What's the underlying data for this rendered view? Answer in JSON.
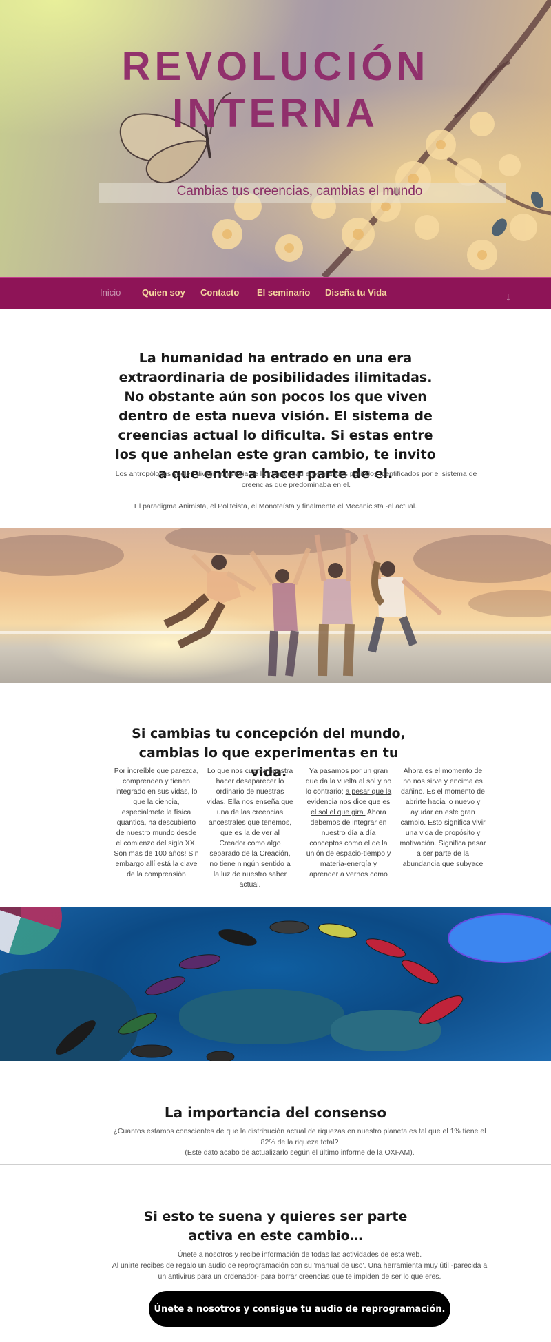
{
  "hero": {
    "title_line1": "REVOLUCIÓN",
    "title_line2": "INTERNA",
    "tagline": "Cambias tus creencias, cambias el mundo"
  },
  "nav": {
    "items": [
      {
        "label": "Inicio",
        "active": true
      },
      {
        "label": "Quien soy",
        "active": false
      },
      {
        "label": "Contacto",
        "active": false
      },
      {
        "label": "El seminario",
        "active": false
      },
      {
        "label": "Diseña tu Vida",
        "active": false
      }
    ],
    "scroll_icon": "arrow-down-icon"
  },
  "intro": {
    "lead": "La humanidad ha entrado en una era extraordinaria de posibilidades ilimitadas. No obstante aún son pocos los que viven dentro de esta nueva visión. El sistema de creencias actual lo dificulta. Si estas entre los que anhelan este gran cambio, te invito a que entre a hacer parte de el.",
    "p1": "Los antropólogos suelen dividir la historia de la humanidad en 4 grandes periodos identificados por el sistema de creencias que predominaba en el.",
    "p2": "El paradigma Animista, el Politeista, el Monoteísta y finalmente el Mecanicista -el actual."
  },
  "section2": {
    "heading": "Si cambias tu concepción del mundo, cambias lo que experimentas en tu vida.",
    "col1": "Por increíble que parezca, comprenden y  tienen integrado en sus vidas, lo que la ciencia, especialmete la física quantica, ha descubierto de nuestro mundo desde el comienzo del siglo XX. Son mas de 100 años! Sin embargo allí está la clave de la comprensión",
    "col2": "Lo que nos cuenta nuestra hacer desaparecer lo ordinario de nuestras vidas. Ella nos enseña que una de las creencias ancestrales que tenemos, que es la de ver al Creador como algo separado de la Creación, no tiene ningún sentido a la luz de nuestro saber actual.",
    "col3_a": "Ya pasamos por un gran que da la vuelta al sol y no lo contrario; ",
    "col3_link": "a pesar que la evidencia nos dice que es el sol el que gira.",
    "col3_b": " Ahora debemos de integrar en nuestro día a día conceptos como el de la unión de espacio-tiempo y materia-energía y aprender a vernos como",
    "col4": "Ahora es el momento de no nos sirve y encima es dañino. Es el momento de abrirte hacia lo nuevo y ayudar en este gran cambio. Esto significa vivir una vida de propósito y motivación. Significa pasar a ser parte de la abundancia que subyace"
  },
  "section3": {
    "heading": "La importancia del consenso",
    "p1": "¿Cuantos estamos conscientes de que la distribución actual de riquezas en nuestro planeta es tal que el 1% tiene el 82% de la riqueza total?",
    "p2": "(Este dato acabo de actualizarlo según el último informe de la OXFAM)."
  },
  "cta": {
    "heading": "Si esto te suena y quieres ser parte activa en este cambio…",
    "p1": "Únete a nosotros y recibe información de todas las actividades de esta web.",
    "p2": "Al unirte recibes de regalo un audio de reprogramación con su 'manual de uso'. Una herramienta muy útil -parecida a un antivirus para un ordenador- para borrar creencias que te impiden de ser lo que eres.",
    "button": "Únete a nosotros y consigue tu audio de reprogramación."
  },
  "colors": {
    "nav_bg": "#8e1457",
    "nav_text": "#f6d8a0",
    "title": "#8f2a6a",
    "button_bg": "#000000"
  }
}
